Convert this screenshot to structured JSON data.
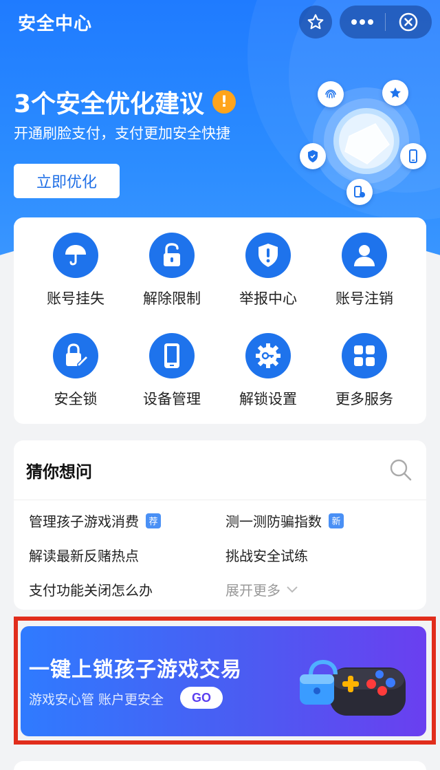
{
  "header": {
    "title": "安全中心",
    "star_icon": "star-outline-icon",
    "more_icon": "more-dots-icon",
    "close_icon": "close-circle-icon"
  },
  "hero": {
    "headline": "3个安全优化建议",
    "warn_badge": "!",
    "subline": "开通刷脸支付，支付更加安全快捷",
    "cta_label": "立即优化",
    "art_icons": [
      "fingerprint-icon",
      "star-icon",
      "phone-icon",
      "phone-lock-icon",
      "shield-check-icon"
    ]
  },
  "services": {
    "items": [
      {
        "label": "账号挂失",
        "icon": "umbrella-icon"
      },
      {
        "label": "解除限制",
        "icon": "unlock-icon"
      },
      {
        "label": "举报中心",
        "icon": "shield-alert-icon"
      },
      {
        "label": "账号注销",
        "icon": "user-icon"
      },
      {
        "label": "安全锁",
        "icon": "lock-edit-icon"
      },
      {
        "label": "设备管理",
        "icon": "mobile-device-icon"
      },
      {
        "label": "解锁设置",
        "icon": "gear-key-icon"
      },
      {
        "label": "更多服务",
        "icon": "grid-apps-icon"
      }
    ]
  },
  "guess": {
    "title": "猜你想问",
    "questions": [
      {
        "text": "管理孩子游戏消费",
        "tag": "荐"
      },
      {
        "text": "测一测防骗指数",
        "tag": "新"
      },
      {
        "text": "解读最新反赌热点",
        "tag": ""
      },
      {
        "text": "挑战安全试练",
        "tag": ""
      },
      {
        "text": "支付功能关闭怎么办",
        "tag": ""
      }
    ],
    "expand_more": "展开更多"
  },
  "banner": {
    "title": "一键上锁孩子游戏交易",
    "subtitle": "游戏安心管 账户更安全",
    "go_label": "GO",
    "art_icon": "lock-gamepad-icon"
  },
  "colors": {
    "brand_blue": "#1e73ec",
    "warn_orange": "#ffa41b",
    "highlight_red": "#e12d1c",
    "banner_purple": "#6a3ff0"
  }
}
